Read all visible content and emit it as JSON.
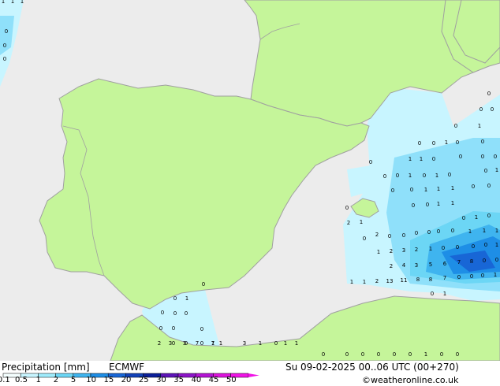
{
  "footer": {
    "title": "Precipitation [mm]",
    "model": "ECMWF",
    "datetime": "Su 09-02-2025 00..06 UTC (00+270)",
    "credit": "©weatheronline.co.uk"
  },
  "legend": {
    "ticks": [
      "0.1",
      "0.5",
      "1",
      "2",
      "5",
      "10",
      "15",
      "20",
      "25",
      "30",
      "35",
      "40",
      "45",
      "50"
    ],
    "colors": [
      "#f5ffff",
      "#c8f5ff",
      "#a0ecfc",
      "#6cd6f5",
      "#3fb4ef",
      "#1e8ee6",
      "#1866d6",
      "#1242b8",
      "#0b1f99",
      "#5e14b8",
      "#8c14c8",
      "#b414d4",
      "#dc14dc",
      "#f014e6"
    ]
  },
  "colors": {
    "sea": "#ececec",
    "land": "#c5f59a",
    "border": "#a0a0a0"
  },
  "map_values": [
    "1",
    "1",
    "1",
    "0",
    "0",
    "0",
    "0",
    "0",
    "1",
    "0",
    "0",
    "0",
    "0",
    "0",
    "0",
    "0",
    "0",
    "0",
    "1",
    "1",
    "1",
    "0",
    "0",
    "0",
    "0",
    "1",
    "0",
    "0",
    "1",
    "0",
    "0",
    "0",
    "1",
    "1",
    "0",
    "0",
    "0",
    "0",
    "0",
    "0",
    "1",
    "0",
    "1",
    "0",
    "0",
    "1",
    "0",
    "0",
    "1",
    "1",
    "1",
    "0",
    "0",
    "0",
    "0",
    "0",
    "1",
    "1",
    "0",
    "1",
    "0",
    "2",
    "1",
    "2",
    "0",
    "0",
    "0",
    "0",
    "0",
    "0",
    "1",
    "1",
    "1",
    "0",
    "1",
    "2",
    "3",
    "2",
    "1",
    "0",
    "0",
    "0",
    "0",
    "1",
    "2",
    "4",
    "3",
    "5",
    "6",
    "7",
    "8",
    "0",
    "0",
    "1",
    "1",
    "2",
    "13",
    "11",
    "8",
    "8",
    "7",
    "0",
    "0",
    "0",
    "1",
    "0",
    "1",
    "2",
    "3",
    "3",
    "7",
    "7",
    "1",
    "3",
    "1",
    "0",
    "0",
    "0",
    "0",
    "0",
    "0",
    "0",
    "1",
    "0",
    "0",
    "0",
    "0",
    "0",
    "1",
    "1",
    "0",
    "0",
    "0",
    "0",
    "0",
    "0"
  ]
}
